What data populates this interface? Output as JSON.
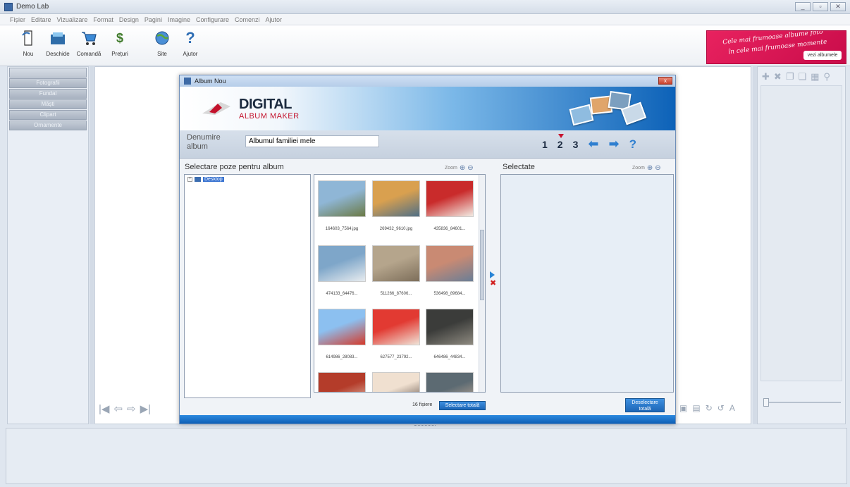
{
  "window": {
    "title": "Demo Lab",
    "controls": [
      "_",
      "▫",
      "✕"
    ]
  },
  "menu": [
    "Fișier",
    "Editare",
    "Vizualizare",
    "Format",
    "Design",
    "Pagini",
    "Imagine",
    "Configurare",
    "Comenzi",
    "Ajutor"
  ],
  "toolbar": {
    "buttons": [
      {
        "label": "Nou",
        "icon": "new-icon"
      },
      {
        "label": "Deschide",
        "icon": "open-icon"
      },
      {
        "label": "Comandă",
        "icon": "cart-icon"
      },
      {
        "label": "Prețuri",
        "icon": "prices-icon"
      },
      {
        "label": "Site",
        "icon": "globe-icon"
      },
      {
        "label": "Ajutor",
        "icon": "help-icon"
      }
    ]
  },
  "promo": {
    "line1": "Cele mai frumoase albume foto",
    "line2": "în cele mai frumoase momente",
    "button": "vezi albumele"
  },
  "left_panel": {
    "items": [
      "",
      "Fotografii",
      "Fundal",
      "Măști",
      "Clipart",
      "Ornamente"
    ]
  },
  "dialog": {
    "title": "Album Nou",
    "close": "x",
    "brand_line1": "DIGITAL",
    "brand_line2": "ALBUM MAKER",
    "name_label": "Denumire album",
    "name_value": "Albumul familiei mele",
    "steps": [
      "1",
      "2",
      "3"
    ],
    "current_step": "2",
    "help": "?",
    "left_title": "Selectare poze pentru album",
    "right_title": "Selectate",
    "zoom_label": "Zoom",
    "tree_node": "Desktop",
    "thumbnails": [
      {
        "caption": "164603_7564.jpg",
        "color1": "#8fb6d6",
        "color2": "#6b7a45"
      },
      {
        "caption": "269432_9610.jpg",
        "color1": "#d9a04f",
        "color2": "#4f6f86"
      },
      {
        "caption": "435836_84601...",
        "color1": "#c92b2b",
        "color2": "#f2ece4"
      },
      {
        "caption": "474133_64476...",
        "color1": "#7ea6c9",
        "color2": "#e8ecef"
      },
      {
        "caption": "511266_87606...",
        "color1": "#b5a58c",
        "color2": "#7d6e5a"
      },
      {
        "caption": "536498_89684...",
        "color1": "#c98a73",
        "color2": "#6a7e96"
      },
      {
        "caption": "614986_28083...",
        "color1": "#8cc0f0",
        "color2": "#d43a2a"
      },
      {
        "caption": "627577_23792...",
        "color1": "#e23a32",
        "color2": "#f0e4d8"
      },
      {
        "caption": "646486_44834...",
        "color1": "#3b3c3a",
        "color2": "#8e8a80"
      },
      {
        "caption": "",
        "color1": "#b43c2a",
        "color2": "#e8d5c4"
      },
      {
        "caption": "",
        "color1": "#f0e0d0",
        "color2": "#4a3a32"
      },
      {
        "caption": "",
        "color1": "#5c6a72",
        "color2": "#d0b49c"
      }
    ],
    "files_count": "16 fișiere",
    "select_all": "Selectare totală",
    "deselect_all_line1": "Deselectare",
    "deselect_all_line2": "totală"
  },
  "colors": {
    "accent": "#1d66b6",
    "promo": "#e8225f",
    "brand_red": "#c3122c"
  }
}
